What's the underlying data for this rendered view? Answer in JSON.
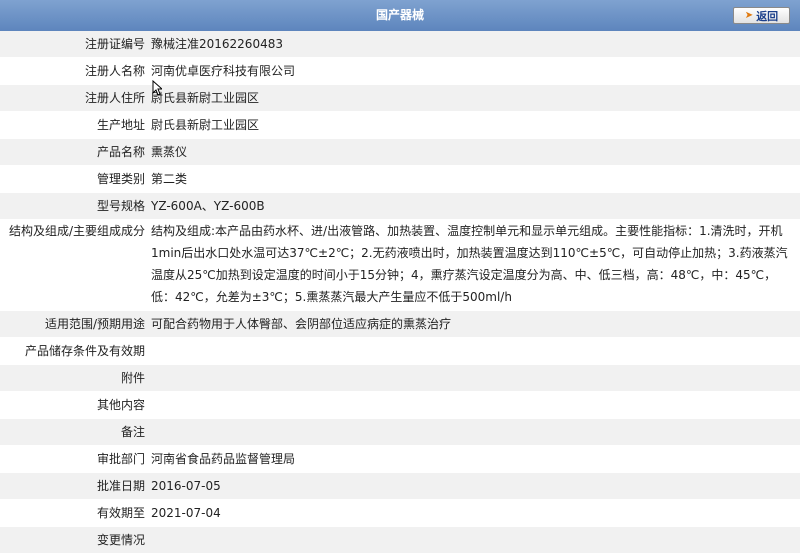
{
  "header": {
    "title": "国产器械",
    "back_label": "返回"
  },
  "rows": [
    {
      "label": "注册证编号",
      "value": "豫械注准20162260483"
    },
    {
      "label": "注册人名称",
      "value": "河南优卓医疗科技有限公司"
    },
    {
      "label": "注册人住所",
      "value": "尉氏县新尉工业园区"
    },
    {
      "label": "生产地址",
      "value": "尉氏县新尉工业园区"
    },
    {
      "label": "产品名称",
      "value": "熏蒸仪"
    },
    {
      "label": "管理类别",
      "value": "第二类"
    },
    {
      "label": "型号规格",
      "value": "YZ-600A、YZ-600B"
    },
    {
      "label": "结构及组成/主要组成成分",
      "value": "结构及组成:本产品由药水杯、进/出液管路、加热装置、温度控制单元和显示单元组成。主要性能指标：1.清洗时，开机1min后出水口处水温可达37℃±2℃；2.无药液喷出时，加热装置温度达到110℃±5℃，可自动停止加热；3.药液蒸汽温度从25℃加热到设定温度的时间小于15分钟；4，熏疗蒸汽设定温度分为高、中、低三档，高：48℃，中：45℃，低：42℃，允差为±3℃；5.熏蒸蒸汽最大产生量应不低于500ml/h"
    },
    {
      "label": "适用范围/预期用途",
      "value": "可配合药物用于人体臀部、会阴部位适应病症的熏蒸治疗"
    },
    {
      "label": "产品储存条件及有效期",
      "value": ""
    },
    {
      "label": "附件",
      "value": ""
    },
    {
      "label": "其他内容",
      "value": ""
    },
    {
      "label": "备注",
      "value": ""
    },
    {
      "label": "审批部门",
      "value": "河南省食品药品监督管理局"
    },
    {
      "label": "批准日期",
      "value": "2016-07-05"
    },
    {
      "label": "有效期至",
      "value": "2021-07-04"
    },
    {
      "label": "变更情况",
      "value": ""
    }
  ]
}
